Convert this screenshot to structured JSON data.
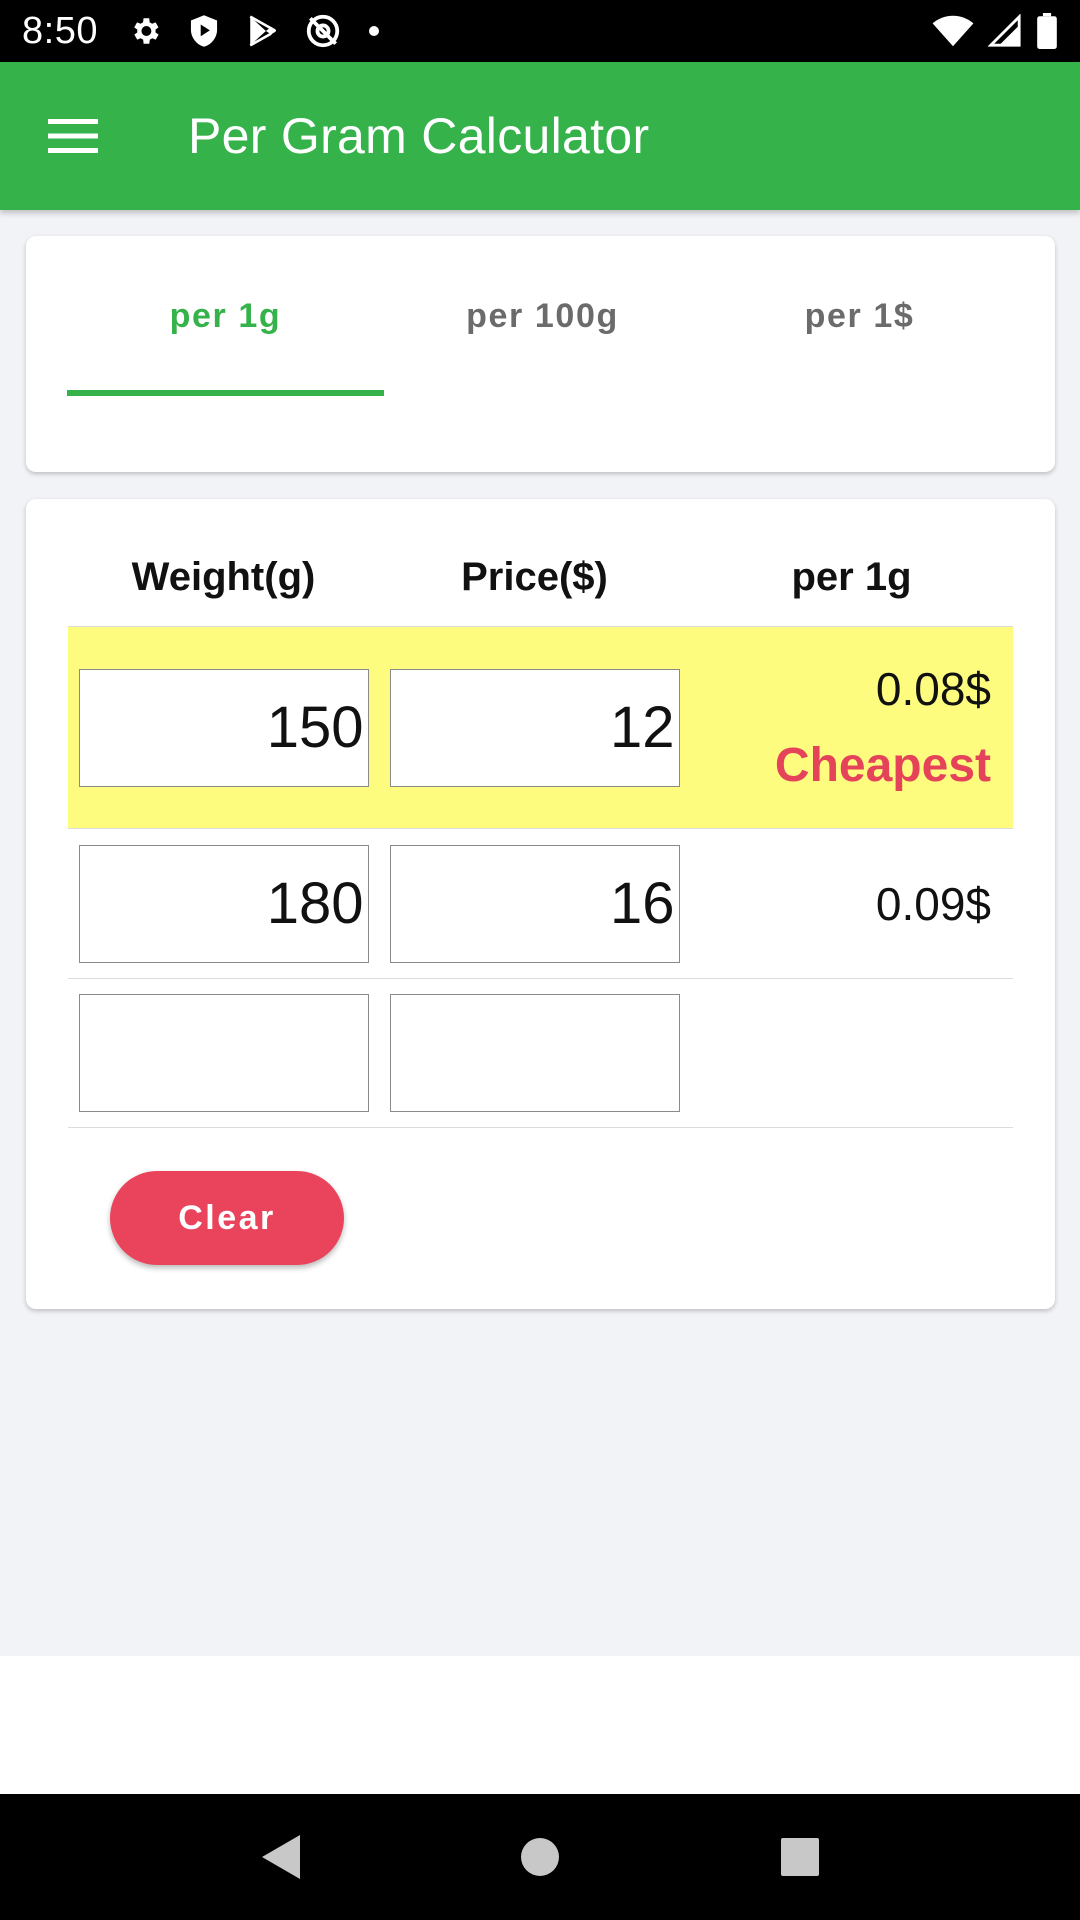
{
  "status_bar": {
    "time": "8:50",
    "left_icons": [
      "gear-icon",
      "shield-play-icon",
      "play-store-icon",
      "at-sign-off-icon",
      "dot-icon"
    ],
    "right_icons": [
      "wifi-icon",
      "cell-signal-icon",
      "battery-icon"
    ]
  },
  "app_bar": {
    "title": "Per Gram Calculator",
    "menu_icon": "hamburger-menu-icon",
    "color": "#35b34a"
  },
  "tabs": [
    {
      "label": "per 1g",
      "active": true
    },
    {
      "label": "per 100g",
      "active": false
    },
    {
      "label": "per 1$",
      "active": false
    }
  ],
  "table": {
    "headers": [
      "Weight(g)",
      "Price($)",
      "per 1g"
    ],
    "rows": [
      {
        "weight": "150",
        "price": "12",
        "result": "0.08$",
        "badge": "Cheapest"
      },
      {
        "weight": "180",
        "price": "16",
        "result": "0.09$",
        "badge": ""
      },
      {
        "weight": "",
        "price": "",
        "result": "",
        "badge": ""
      }
    ]
  },
  "clear_button": {
    "label": "Clear",
    "color": "#ea445c"
  },
  "highlight_color": "#fdfc7f",
  "nav_bar": {
    "icons": [
      "back-icon",
      "home-icon",
      "recents-icon"
    ]
  }
}
